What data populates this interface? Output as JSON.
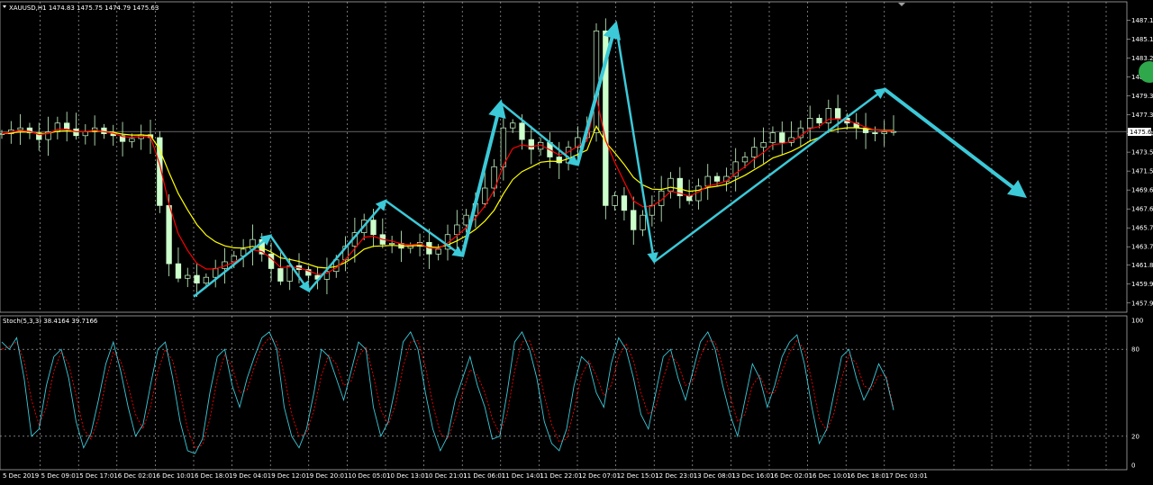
{
  "chart_data": [
    {
      "type": "candlestick",
      "title": "XAUUSD,H1 1474.83 1475.75 1474.79 1475.63",
      "current_price_label": "1475.63",
      "ylim": [
        1457.0,
        1489.0
      ],
      "y_ticks": [
        "1487.10",
        "1485.15",
        "1483.20",
        "1481.25",
        "1479.30",
        "1477.35",
        "1475.40",
        "1473.50",
        "1471.55",
        "1469.60",
        "1467.65",
        "1465.70",
        "1463.75",
        "1461.85",
        "1459.90",
        "1457.95"
      ],
      "x_ticks": [
        "5 Dec 2019",
        "5 Dec 09:01",
        "5 Dec 17:01",
        "6 Dec 02:01",
        "6 Dec 10:01",
        "6 Dec 18:01",
        "9 Dec 04:01",
        "9 Dec 12:01",
        "9 Dec 20:01",
        "10 Dec 05:01",
        "10 Dec 13:01",
        "10 Dec 21:01",
        "11 Dec 06:01",
        "11 Dec 14:01",
        "11 Dec 22:01",
        "12 Dec 07:01",
        "12 Dec 15:01",
        "12 Dec 23:01",
        "13 Dec 08:01",
        "13 Dec 16:01",
        "16 Dec 02:01",
        "16 Dec 10:01",
        "16 Dec 18:01",
        "17 Dec 03:01"
      ],
      "close_path": [
        1475.4,
        1475.8,
        1476.0,
        1475.5,
        1474.8,
        1475.6,
        1476.5,
        1475.9,
        1475.2,
        1475.6,
        1476.0,
        1475.4,
        1475.2,
        1474.6,
        1474.9,
        1475.3,
        1475.0,
        1468.0,
        1462.0,
        1460.5,
        1460.8,
        1460.0,
        1460.6,
        1461.5,
        1462.2,
        1462.8,
        1463.5,
        1464.5,
        1463.0,
        1461.5,
        1460.2,
        1461.8,
        1461.4,
        1460.8,
        1460.4,
        1461.2,
        1462.4,
        1463.8,
        1465.2,
        1466.5,
        1465.0,
        1464.0,
        1464.1,
        1463.6,
        1463.8,
        1464.2,
        1463.0,
        1463.5,
        1465.0,
        1466.0,
        1467.0,
        1468.2,
        1469.8,
        1472.0,
        1476.0,
        1476.5,
        1474.8,
        1473.8,
        1474.5,
        1473.0,
        1472.4,
        1474.0,
        1475.0,
        1475.5,
        1486.0,
        1468.0,
        1469.0,
        1467.5,
        1465.5,
        1467.0,
        1468.0,
        1469.5,
        1470.8,
        1469.0,
        1468.5,
        1470.0,
        1471.0,
        1470.5,
        1471.0,
        1472.5,
        1473.0,
        1474.0,
        1474.5,
        1475.5,
        1474.5,
        1475.0,
        1476.0,
        1477.0,
        1476.5,
        1478.0,
        1477.0,
        1476.5,
        1476.0,
        1475.5,
        1475.4,
        1475.6,
        1475.63
      ],
      "annotations": {
        "arrows": [
          {
            "from": [
              "6 Dec 18:01",
              1458.6
            ],
            "to": [
              "9 Dec 12:01",
              1464.9
            ]
          },
          {
            "from": [
              "9 Dec 12:01",
              1464.9
            ],
            "to": [
              "9 Dec 20:01",
              1459.2
            ]
          },
          {
            "from": [
              "9 Dec 20:01",
              1459.2
            ],
            "to": [
              "10 Dec 13:01",
              1468.5
            ]
          },
          {
            "from": [
              "10 Dec 13:01",
              1468.5
            ],
            "to": [
              "11 Dec 06:01",
              1462.8
            ]
          },
          {
            "from": [
              "11 Dec 06:01",
              1462.8
            ],
            "to": [
              "11 Dec 14:01",
              1478.6
            ]
          },
          {
            "from": [
              "11 Dec 14:01",
              1478.6
            ],
            "to": [
              "12 Dec 07:01",
              1472.2
            ]
          },
          {
            "from": [
              "12 Dec 07:01",
              1472.2
            ],
            "to": [
              "12 Dec 15:01",
              1486.7
            ]
          },
          {
            "from": [
              "12 Dec 15:01",
              1486.7
            ],
            "to": [
              "12 Dec 23:01",
              1462.2
            ]
          },
          {
            "from": [
              "12 Dec 23:01",
              1462.2
            ],
            "to": [
              "17 Dec 03:01",
              1480.0
            ]
          },
          {
            "from": [
              "17 Dec 03:01",
              1480.0
            ],
            "to": [
              "17 Dec 03:01+",
              1469.0
            ]
          }
        ]
      },
      "colors": {
        "bull": "#ccffcc",
        "bear": "#ccffcc",
        "ma_fast": "#ff0000",
        "ma_slow": "#ffff00",
        "arrows": "#3cc9d8",
        "grid": "#c0c0c0"
      }
    },
    {
      "type": "line",
      "title": "Stoch(5,3,3) 38.4164 39.7166",
      "ylim": [
        0,
        100
      ],
      "y_ticks": [
        "100",
        "80",
        "20",
        "0"
      ],
      "levels": [
        20,
        80
      ],
      "series": [
        {
          "values": [
            85,
            80,
            88,
            60,
            20,
            25,
            55,
            75,
            80,
            60,
            30,
            12,
            22,
            45,
            70,
            85,
            65,
            40,
            20,
            28,
            55,
            80,
            85,
            60,
            30,
            10,
            8,
            18,
            50,
            75,
            80,
            55,
            40,
            60,
            75,
            88,
            92,
            80,
            40,
            20,
            12,
            25,
            50,
            80,
            75,
            60,
            45,
            65,
            85,
            80,
            40,
            20,
            30,
            55,
            85,
            92,
            80,
            50,
            25,
            10,
            20,
            45,
            60,
            75,
            55,
            40,
            18,
            20,
            50,
            85,
            92,
            80,
            60,
            30,
            15,
            10,
            25,
            55,
            75,
            70,
            50,
            40,
            70,
            88,
            80,
            60,
            35,
            25,
            50,
            75,
            80,
            60,
            45,
            65,
            85,
            92,
            80,
            55,
            35,
            20,
            45,
            70,
            60,
            40,
            55,
            75,
            85,
            90,
            70,
            40,
            15,
            25,
            50,
            75,
            80,
            60,
            45,
            55,
            70,
            60,
            38
          ]
        },
        {
          "values": [
            80,
            82,
            85,
            72,
            45,
            28,
            40,
            65,
            78,
            70,
            48,
            25,
            18,
            32,
            58,
            78,
            72,
            55,
            35,
            25,
            40,
            65,
            80,
            72,
            50,
            25,
            12,
            14,
            32,
            60,
            76,
            68,
            50,
            52,
            68,
            82,
            88,
            85,
            62,
            35,
            20,
            22,
            38,
            62,
            76,
            70,
            55,
            58,
            75,
            82,
            62,
            38,
            28,
            42,
            68,
            85,
            86,
            68,
            42,
            22,
            18,
            32,
            50,
            66,
            62,
            50,
            32,
            22,
            35,
            65,
            85,
            86,
            72,
            48,
            28,
            16,
            18,
            38,
            62,
            72,
            62,
            48,
            55,
            75,
            84,
            72,
            50,
            35,
            40,
            60,
            76,
            70,
            55,
            58,
            75,
            86,
            85,
            68,
            48,
            30,
            35,
            55,
            62,
            50,
            50,
            65,
            78,
            86,
            80,
            58,
            32,
            24,
            36,
            60,
            76,
            70,
            55,
            52,
            62,
            62,
            39.7
          ]
        }
      ],
      "colors": {
        "main": "#3cc9d8",
        "signal": "#ff0000"
      }
    }
  ]
}
